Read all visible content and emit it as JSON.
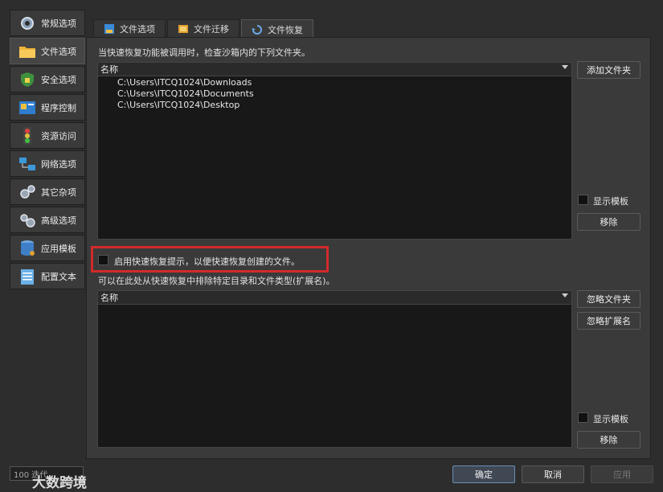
{
  "sidebar": {
    "items": [
      {
        "label": "常规选项",
        "icon": "gear-icon"
      },
      {
        "label": "文件选项",
        "icon": "folder-icon",
        "active": true
      },
      {
        "label": "安全选项",
        "icon": "shield-icon"
      },
      {
        "label": "程序控制",
        "icon": "program-icon"
      },
      {
        "label": "资源访问",
        "icon": "traffic-light-icon"
      },
      {
        "label": "网络选项",
        "icon": "network-icon"
      },
      {
        "label": "其它杂项",
        "icon": "gears-icon"
      },
      {
        "label": "高级选项",
        "icon": "advanced-gears-icon"
      },
      {
        "label": "应用模板",
        "icon": "database-icon"
      },
      {
        "label": "配置文本",
        "icon": "notepad-icon"
      }
    ]
  },
  "tabs": [
    {
      "label": "文件选项",
      "icon": "file-options-icon"
    },
    {
      "label": "文件迁移",
      "icon": "file-migration-icon"
    },
    {
      "label": "文件恢复",
      "icon": "file-recovery-icon",
      "active": true
    }
  ],
  "recovery": {
    "description": "当快速恢复功能被调用时，检查沙箱内的下列文件夹。",
    "list_header": "名称",
    "folders": [
      "C:\\Users\\ITCQ1024\\Downloads",
      "C:\\Users\\ITCQ1024\\Documents",
      "C:\\Users\\ITCQ1024\\Desktop"
    ],
    "add_folder": "添加文件夹",
    "show_templates": "显示模板",
    "remove": "移除"
  },
  "immediate": {
    "checkbox_label": "启用快速恢复提示，以便快速恢复创建的文件。",
    "checked": false
  },
  "exclude": {
    "description": "可以在此处从快速恢复中排除特定目录和文件类型(扩展名)。",
    "list_header": "名称",
    "ignore_folder": "忽略文件夹",
    "ignore_ext": "忽略扩展名",
    "show_templates": "显示模板",
    "remove": "移除"
  },
  "footer": {
    "ok": "确定",
    "cancel": "取消",
    "apply": "应用"
  },
  "watermark": {
    "logo_text": "100 迭代",
    "text": "大数跨境"
  },
  "colors": {
    "highlight": "#d22a2a",
    "background": "#2d2d2d"
  }
}
